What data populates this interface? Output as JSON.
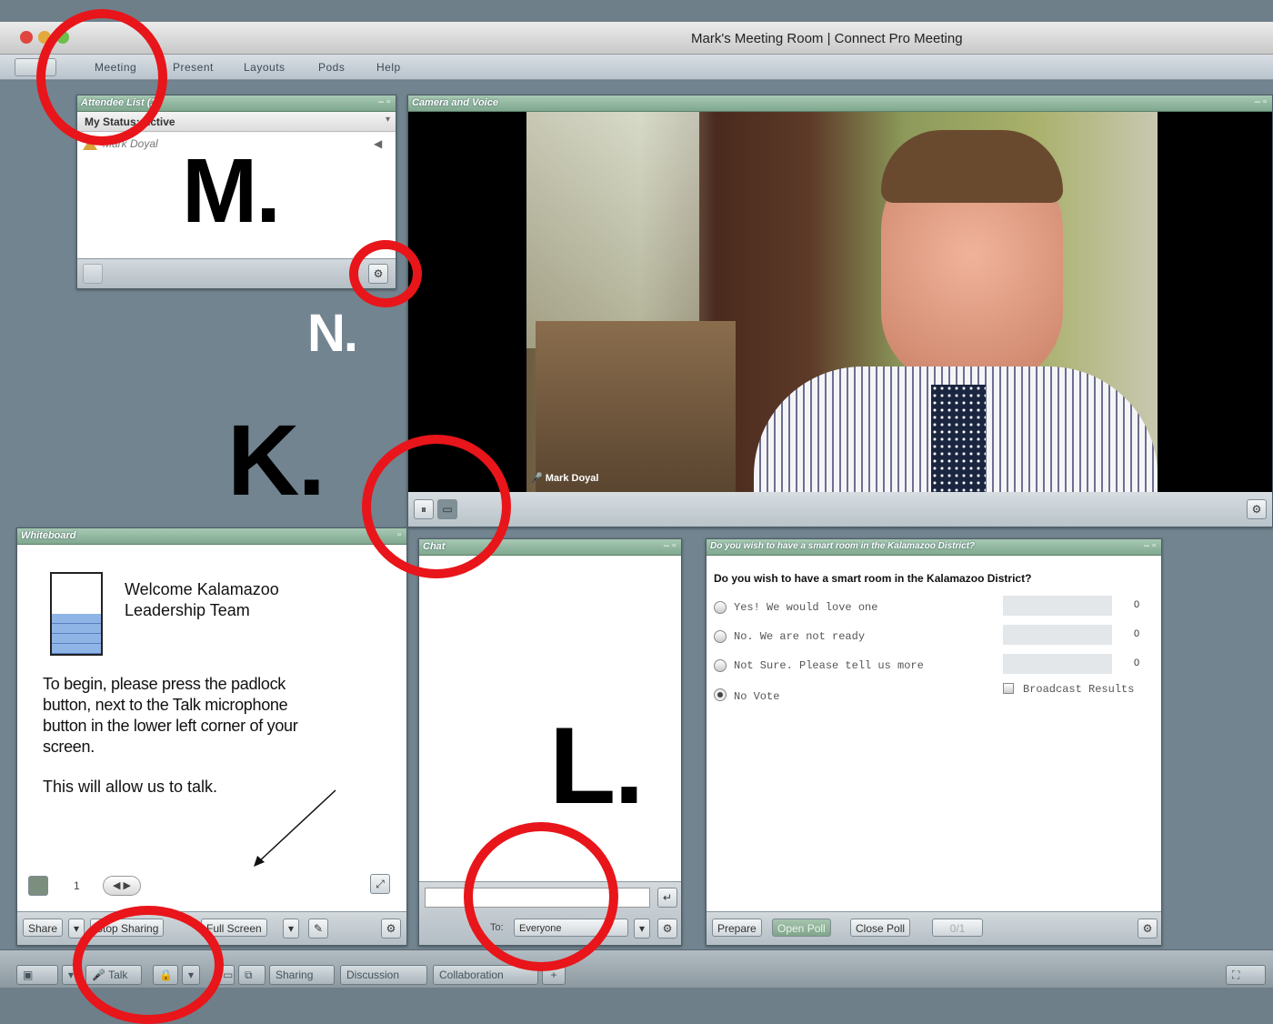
{
  "window": {
    "title": "Mark's Meeting Room | Connect Pro Meeting"
  },
  "menu": {
    "items": [
      "Meeting",
      "Present",
      "Layouts",
      "Pods",
      "Help"
    ]
  },
  "attendees": {
    "title": "Attendee List (1)",
    "my_status": "My Status: Active",
    "people": [
      "Mark Doyal"
    ]
  },
  "camera": {
    "title": "Camera and Voice",
    "speaker": "Mark Doyal"
  },
  "whiteboard": {
    "title": "Whiteboard",
    "welcome": "Welcome Kalamazoo Leadership Team",
    "instructions": "To begin, please press the padlock button, next to the Talk microphone button in the lower left corner of your screen.",
    "note": "This will allow us to talk.",
    "page": "1",
    "buttons": {
      "share": "Share",
      "stop": "Stop Sharing",
      "full": "Full Screen"
    }
  },
  "chat": {
    "title": "Chat",
    "to_label": "To:",
    "to_value": "Everyone"
  },
  "poll": {
    "title": "Do you wish to have a smart room in the Kalamazoo District?",
    "question": "Do you wish to have a smart room in the Kalamazoo District?",
    "options": [
      {
        "label": "Yes!  We would love one",
        "count": "0"
      },
      {
        "label": "No.  We are not ready",
        "count": "0"
      },
      {
        "label": "Not Sure.  Please tell us more",
        "count": "0"
      },
      {
        "label": "No Vote",
        "count": ""
      }
    ],
    "broadcast": "Broadcast Results",
    "buttons": {
      "prepare": "Prepare",
      "open": "Open Poll",
      "close": "Close Poll",
      "progress": "0/1"
    }
  },
  "taskbar": {
    "talk": "Talk",
    "sharing": "Sharing",
    "discussion": "Discussion",
    "collaboration": "Collaboration",
    "add": "+"
  },
  "annotations": {
    "m": "M.",
    "n": "N.",
    "k": "K.",
    "l": "L."
  }
}
